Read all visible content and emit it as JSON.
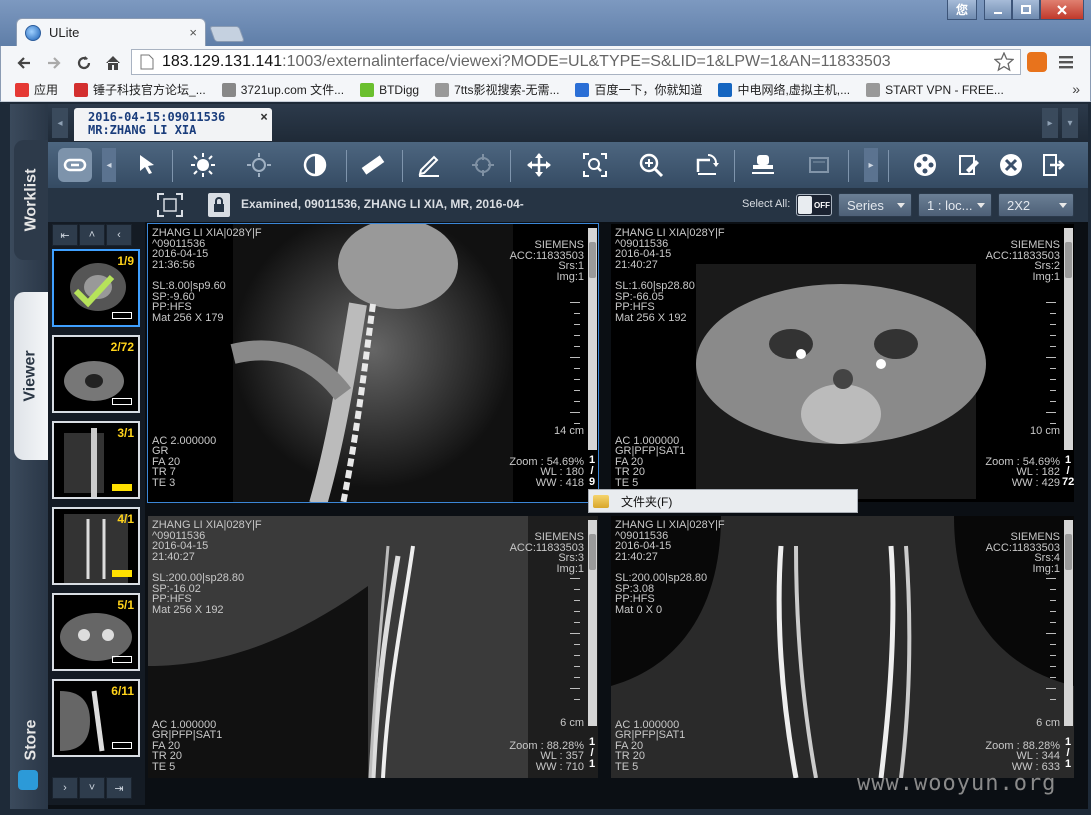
{
  "browser": {
    "tab_title": "ULite",
    "tab_close": "×",
    "url_host": "183.129.131.141",
    "url_rest": ":1003/externalinterface/viewexi?MODE=UL&TYPE=S&LID=1&LPW=1&AN=11833503",
    "win_user": "您",
    "bookmarks": [
      {
        "label": "应用",
        "color": "#e53935"
      },
      {
        "label": "锤子科技官方论坛_...",
        "color": "#d32f2f"
      },
      {
        "label": "3721up.com 文件...",
        "color": "#888888"
      },
      {
        "label": "BTDigg",
        "color": "#6abf2e"
      },
      {
        "label": "7tts影视搜索-无需...",
        "color": "#999999"
      },
      {
        "label": "百度一下，你就知道",
        "color": "#2b6fd6"
      },
      {
        "label": "中电网络,虚拟主机,...",
        "color": "#1565c0"
      },
      {
        "label": "START VPN - FREE...",
        "color": "#999999"
      }
    ],
    "more": "»"
  },
  "app": {
    "side_tabs": {
      "worklist": "Worklist",
      "viewer": "Viewer",
      "store": "Store"
    },
    "study_tab": {
      "line1": "2016-04-15:09011536",
      "line2": "MR:ZHANG LI XIA",
      "close": "×"
    },
    "info_text": "Examined, 09011536, ZHANG LI XIA, MR, 2016-04-",
    "select_all_label": "Select All:",
    "toggle_label": "OFF",
    "mode_select": "Series",
    "layout1_select": "1 : loc...",
    "layout2_select": "2X2",
    "thumb_nav_top": [
      "⇤",
      "˄",
      "‹"
    ],
    "thumb_nav_bottom": [
      "›",
      "˅",
      "⇥"
    ],
    "thumbnails": [
      "1/9",
      "2/72",
      "3/1",
      "4/1",
      "5/1",
      "6/11"
    ],
    "context_menu": "文件夹(F)",
    "watermark": "www.wooyun.org"
  },
  "viewports": [
    {
      "tl": "ZHANG LI XIA|028Y|F\n^09011536\n2016-04-15\n21:36:56",
      "tl2": "SL:8.00|sp9.60\nSP:-9.60\nPP:HFS\nMat 256 X 179",
      "tr": "SIEMENS\nACC:11833503\nSrs:1\nImg:1",
      "bl": "AC 2.000000\nGR\nFA 20\nTR 7\nTE 3",
      "scale": "14 cm",
      "br": "Zoom : 54.69%\nWL : 180\nWW : 418",
      "frac": [
        "1",
        "/",
        "9"
      ]
    },
    {
      "tl": "ZHANG LI XIA|028Y|F\n^09011536\n2016-04-15\n21:40:27",
      "tl2": "SL:1.60|sp28.80\nSP:-66.05\nPP:HFS\nMat 256 X 192",
      "tr": "SIEMENS\nACC:11833503\nSrs:2\nImg:1",
      "bl": "AC 1.000000\nGR|PFP|SAT1\nFA 20\nTR 20\nTE 5",
      "scale": "10 cm",
      "br": "Zoom : 54.69%\nWL : 182\nWW : 429",
      "frac": [
        "1",
        "/",
        "72"
      ]
    },
    {
      "tl": "ZHANG LI XIA|028Y|F\n^09011536\n2016-04-15\n21:40:27",
      "tl2": "SL:200.00|sp28.80\nSP:-16.02\nPP:HFS\nMat 256 X 192",
      "tr": "SIEMENS\nACC:11833503\nSrs:3\nImg:1",
      "bl": "AC 1.000000\nGR|PFP|SAT1\nFA 20\nTR 20\nTE 5",
      "scale": "6 cm",
      "br": "Zoom : 88.28%\nWL : 357\nWW : 710",
      "frac": [
        "1",
        "/",
        "1"
      ]
    },
    {
      "tl": "ZHANG LI XIA|028Y|F\n^09011536\n2016-04-15\n21:40:27",
      "tl2": "SL:200.00|sp28.80\nSP:3.08\nPP:HFS\nMat 0 X 0",
      "tr": "SIEMENS\nACC:11833503\nSrs:4\nImg:1",
      "bl": "AC 1.000000\nGR|PFP|SAT1\nFA 20\nTR 20\nTE 5",
      "scale": "6 cm",
      "br": "Zoom : 88.28%\nWL : 344\nWW : 633",
      "frac": [
        "1",
        "/",
        "1"
      ]
    }
  ]
}
